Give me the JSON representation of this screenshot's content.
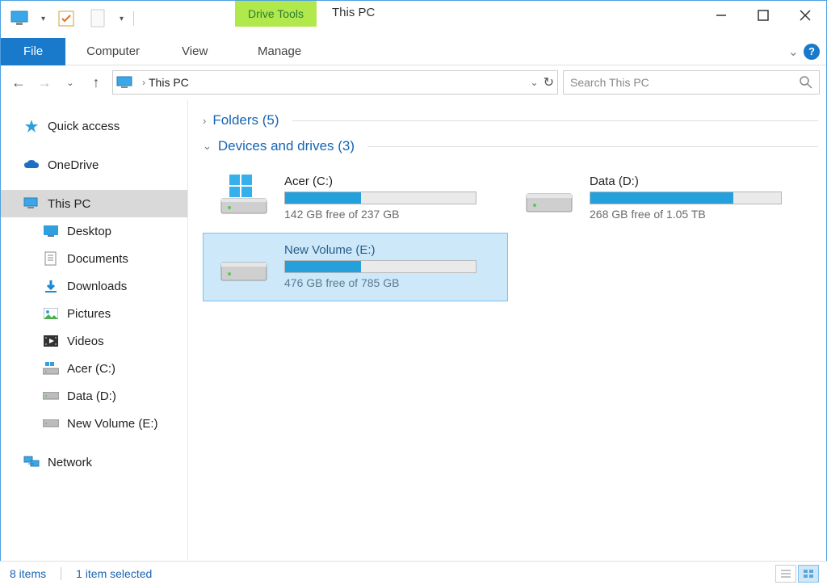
{
  "window": {
    "title": "This PC",
    "drive_tools_label": "Drive Tools"
  },
  "ribbon": {
    "file": "File",
    "computer": "Computer",
    "view": "View",
    "manage": "Manage"
  },
  "address": {
    "location": "This PC"
  },
  "search": {
    "placeholder": "Search This PC"
  },
  "sidebar": {
    "quick_access": "Quick access",
    "onedrive": "OneDrive",
    "this_pc": "This PC",
    "desktop": "Desktop",
    "documents": "Documents",
    "downloads": "Downloads",
    "pictures": "Pictures",
    "videos": "Videos",
    "acer_c": "Acer (C:)",
    "data_d": "Data (D:)",
    "new_vol_e": "New Volume (E:)",
    "network": "Network"
  },
  "sections": {
    "folders": "Folders (5)",
    "devices": "Devices and drives (3)"
  },
  "drives": [
    {
      "name": "Acer (C:)",
      "free_text": "142 GB free of 237 GB",
      "fill_pct": 40,
      "os": true
    },
    {
      "name": "Data (D:)",
      "free_text": "268 GB free of 1.05 TB",
      "fill_pct": 75,
      "os": false
    },
    {
      "name": "New Volume (E:)",
      "free_text": "476 GB free of 785 GB",
      "fill_pct": 40,
      "os": false,
      "selected": true
    }
  ],
  "status": {
    "items": "8 items",
    "selection": "1 item selected"
  }
}
